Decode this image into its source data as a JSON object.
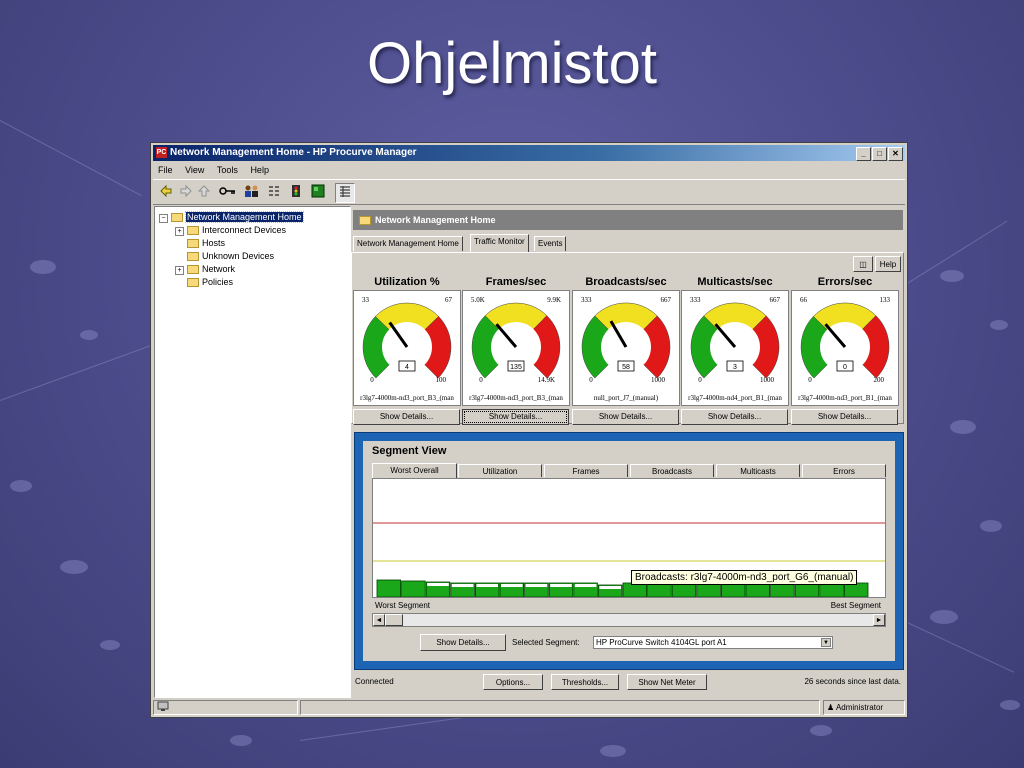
{
  "slide": {
    "title": "Ohjelmistot"
  },
  "window": {
    "title": "Network Management Home - HP Procurve Manager",
    "app_icon": "PC",
    "controls": {
      "minimize": "_",
      "maximize": "□",
      "close": "✕"
    },
    "menu": [
      "File",
      "View",
      "Tools",
      "Help"
    ],
    "toolbar_icons": [
      "back-arrow",
      "forward-arrow",
      "up-arrow",
      "key",
      "users",
      "list-tree",
      "traffic-light",
      "green-board",
      "grid-list"
    ]
  },
  "tree": {
    "root": "Network Management Home",
    "items": [
      {
        "label": "Interconnect Devices",
        "expander": "+"
      },
      {
        "label": "Hosts",
        "expander": ""
      },
      {
        "label": "Unknown Devices",
        "expander": ""
      },
      {
        "label": "Network",
        "expander": "+"
      },
      {
        "label": "Policies",
        "expander": ""
      }
    ],
    "root_expander": "−"
  },
  "panel": {
    "header": "Network Management Home",
    "tabs": [
      "Network Management Home",
      "Traffic Monitor",
      "Events"
    ],
    "active_tab": "Traffic Monitor",
    "help_label": "Help",
    "gauges": [
      {
        "title": "Utilization %",
        "low": "33",
        "high": "67",
        "min": "0",
        "max": "100",
        "value": "4",
        "source": "r3lg7-4000m-nd3_port_B3_(man",
        "details": "Show Details..."
      },
      {
        "title": "Frames/sec",
        "low": "5.0K",
        "high": "9.9K",
        "min": "0",
        "max": "14.9K",
        "value": "135",
        "source": "r3lg7-4000m-nd3_port_B3_(man",
        "details": "Show Details..."
      },
      {
        "title": "Broadcasts/sec",
        "low": "333",
        "high": "667",
        "min": "0",
        "max": "1000",
        "value": "58",
        "source": "null_port_J7_(manual)",
        "details": "Show Details..."
      },
      {
        "title": "Multicasts/sec",
        "low": "333",
        "high": "667",
        "min": "0",
        "max": "1000",
        "value": "3",
        "source": "r3lg7-4000m-nd4_port_B1_(man",
        "details": "Show Details..."
      },
      {
        "title": "Errors/sec",
        "low": "66",
        "high": "133",
        "min": "0",
        "max": "200",
        "value": "0",
        "source": "r3lg7-4000m-nd3_port_B1_(man",
        "details": "Show Details..."
      }
    ]
  },
  "segment_view": {
    "title": "Segment View",
    "tabs": [
      "Worst Overall",
      "Utilization",
      "Frames",
      "Broadcasts",
      "Multicasts",
      "Errors"
    ],
    "active_tab": "Worst Overall",
    "tooltip": "Broadcasts: r3lg7-4000m-nd3_port_G6_(manual)",
    "worst_label": "Worst Segment",
    "best_label": "Best Segment",
    "details_button": "Show Details...",
    "selected_label": "Selected Segment:",
    "selected_value": "HP ProCurve Switch 4104GL  port  A1",
    "scroll_left": "◄",
    "scroll_right": "►",
    "dropdown_arrow": "▼"
  },
  "bottom": {
    "connected": "Connected",
    "options": "Options...",
    "thresholds": "Thresholds...",
    "show_net_meter": "Show Net Meter",
    "last_data": "26 seconds since last data."
  },
  "status": {
    "user": "Administrator"
  },
  "colors": {
    "green": "#1aa81a",
    "yellow": "#f0e020",
    "red": "#e01818",
    "accent": "#1e64b4"
  }
}
